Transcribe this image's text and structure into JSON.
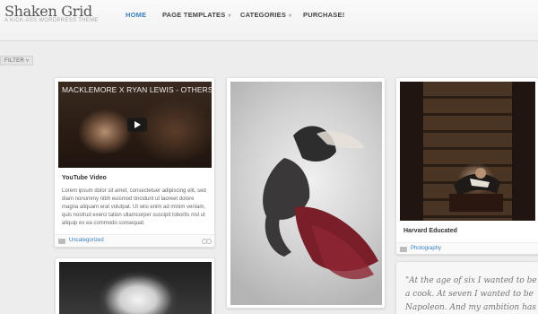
{
  "site": {
    "title": "Shaken Grid",
    "tagline": "A KICK-ASS WORDPRESS THEME"
  },
  "nav": {
    "items": [
      {
        "label": "HOME",
        "active": true
      },
      {
        "label": "PAGE TEMPLATES",
        "active": false,
        "has_dropdown": true
      },
      {
        "label": "CATEGORIES",
        "active": false,
        "has_dropdown": true
      },
      {
        "label": "PURCHASE!",
        "active": false
      }
    ],
    "active_color": "#3a7fc0"
  },
  "filter": {
    "label": "FILTER"
  },
  "posts": {
    "video": {
      "video_title": "MACKLEMORE X RYAN LEWIS - OTHERS",
      "title": "YouTube Video",
      "excerpt": "Lorem ipsum dolor sit amet, consectetuer adipiscing elit, sed diam nonummy nibh euismod tincidunt ut laoreet dolore magna aliquam erat volutpat. Ut wisi enim ad minim veniam, quis nostrud exerci tation ullamcorper suscipit lobortis nisl ut aliquip ex ea commodo consequat.",
      "category": "Uncategorized"
    },
    "library": {
      "title": "Harvard Educated",
      "category": "Photography"
    },
    "quote": {
      "text": "\"At the age of six I wanted to be a cook. At seven I wanted to be Napoleon. And my ambition has been"
    }
  }
}
